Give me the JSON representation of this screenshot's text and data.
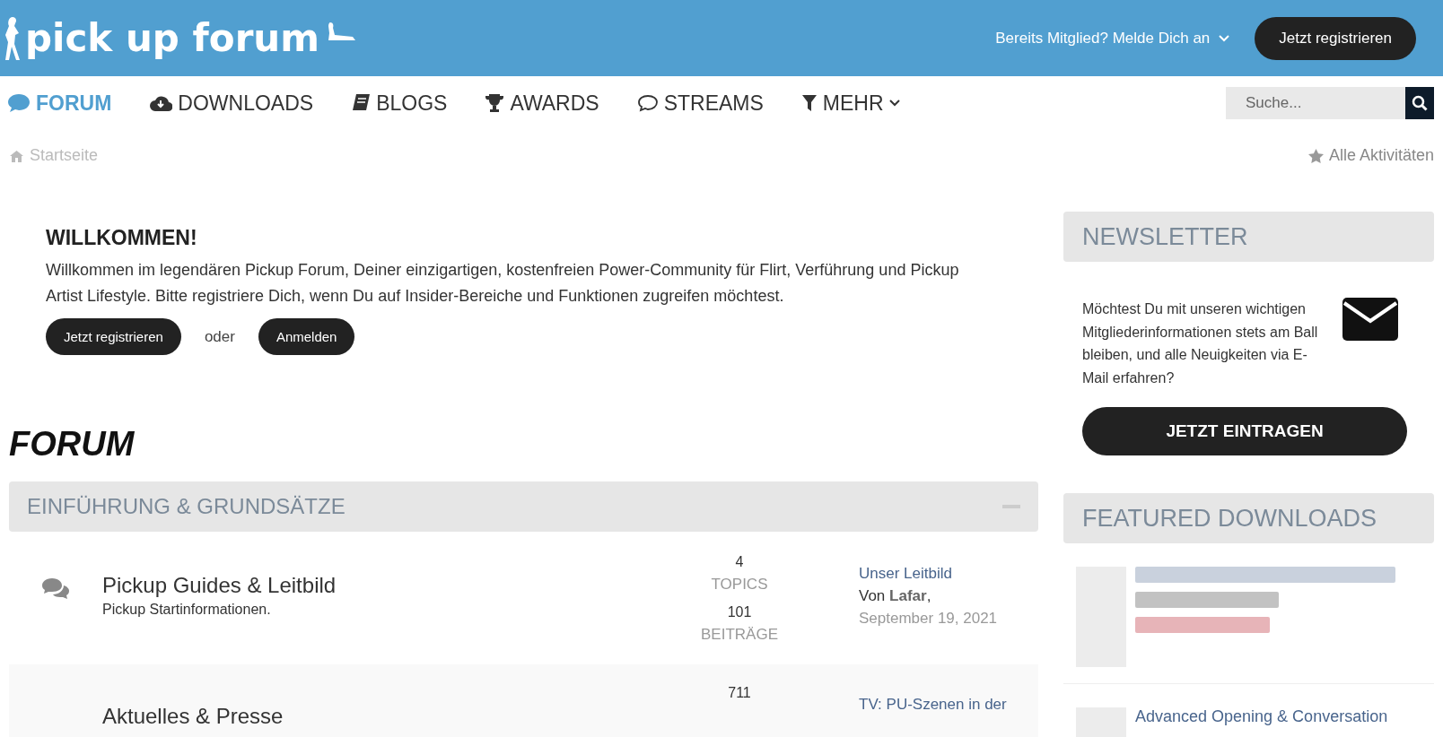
{
  "header": {
    "logo": "pick up forum",
    "login": "Bereits Mitglied? Melde Dich an",
    "register": "Jetzt registrieren"
  },
  "nav": [
    {
      "label": "FORUM",
      "selected": true
    },
    {
      "label": "DOWNLOADS",
      "selected": false
    },
    {
      "label": "BLOGS",
      "selected": false
    },
    {
      "label": "AWARDS",
      "selected": false
    },
    {
      "label": "STREAMS",
      "selected": false
    },
    {
      "label": "MEHR",
      "selected": false,
      "dropdown": true
    }
  ],
  "search": {
    "placeholder": "Suche..."
  },
  "breadcrumb": {
    "home": "Startseite",
    "activity": "Alle Aktivitäten"
  },
  "welcome": {
    "title": "WILLKOMMEN!",
    "text": "Willkommen im legendären Pickup Forum, Deiner einzigartigen, kostenfreien Power-Community für Flirt, Verführung und Pickup Artist Lifestyle. Bitte registriere Dich, wenn Du auf Insider-Bereiche und Funktionen zugreifen möchtest.",
    "register": "Jetzt registrieren",
    "or": "oder",
    "login": "Anmelden"
  },
  "forum": {
    "title": "FORUM",
    "category": "EINFÜHRUNG & GRUNDSÄTZE",
    "rows": [
      {
        "title": "Pickup Guides & Leitbild",
        "description": "Pickup Startinformationen.",
        "topics": "4",
        "topics_label": "TOPICS",
        "posts": "101",
        "posts_label": "BEITRÄGE",
        "last_title": "Unser Leitbild",
        "last_by": "Von **Lafar**,",
        "last_date": "September 19, 2021"
      },
      {
        "title": "Aktuelles & Presse",
        "topics": "711",
        "last_title": "TV: PU-Szenen in der"
      }
    ]
  },
  "newsletter": {
    "title": "NEWSLETTER",
    "text": "Möchtest Du mit unseren wichtigen Mitgliederinformationen stets am Ball bleiben, und alle Neuigkeiten via E-Mail erfahren?",
    "button": "JETZT EINTRAGEN"
  },
  "featured": {
    "title": "FEATURED DOWNLOADS",
    "items": [
      {
        "kind": "blurred"
      },
      {
        "kind": "item",
        "title": "Advanced Opening & Conversation"
      }
    ]
  }
}
